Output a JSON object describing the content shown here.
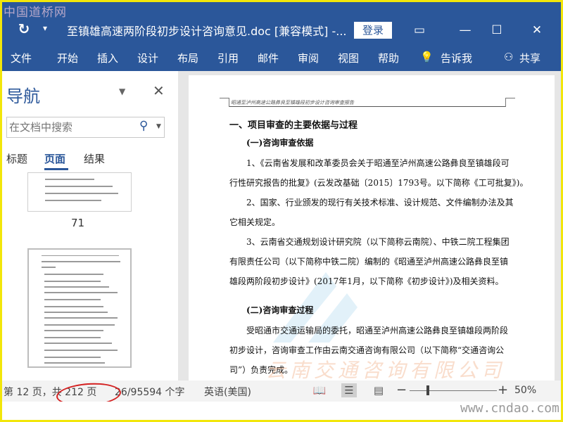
{
  "watermark_top": "中国道桥网",
  "watermark_bottom": "www.cndao.com",
  "watermark_page": "云南交通咨询有限公司",
  "titlebar": {
    "doc_title": "至镇雄高速两阶段初步设计咨询意见.doc [兼容模式]  -...",
    "login_label": "登录",
    "ribbon_display_icon": "ribbon-display-icon",
    "minimize_icon": "minimize-icon",
    "restore_icon": "restore-icon",
    "close_icon": "close-icon"
  },
  "menu": {
    "items": [
      "文件",
      "开始",
      "插入",
      "设计",
      "布局",
      "引用",
      "邮件",
      "审阅",
      "视图",
      "帮助"
    ],
    "tell_me": "告诉我",
    "share": "共享"
  },
  "nav": {
    "title": "导航",
    "search_placeholder": "在文档中搜索",
    "tabs": [
      "标题",
      "页面",
      "结果"
    ],
    "active_tab": "页面",
    "thumb_page_label": "71"
  },
  "document": {
    "header_text": "昭通至泸州高速公路彝良至镇雄段初步设计咨询审查报告",
    "heading1": "一、项目审查的主要依据与过程",
    "heading_a": "(一)咨询审查依据",
    "lines": [
      "1、《云南省发展和改革委员会关于昭通至泸州高速公路彝良至镇雄段可",
      "行性研究报告的批复》(云发改基础〔2015〕1793号。以下简称《工可批复》)。",
      "2、国家、行业颁发的现行有关技术标准、设计规范、文件编制办法及其",
      "它相关规定。",
      "3、云南省交通规划设计研究院（以下简称云南院）、中铁二院工程集团",
      "有限责任公司（以下简称中铁二院）编制的《昭通至泸州高速公路彝良至镇",
      "雄段两阶段初步设计》(2017年1月，以下简称《初步设计》)及相关资料。"
    ],
    "heading_b": "(二)咨询审查过程",
    "lines2": [
      "受昭通市交通运输局的委托，昭通至泸州高速公路彝良至镇雄段两阶段",
      "初步设计，咨询审查工作由云南交通咨询有限公司（以下简称“交通咨询公",
      "司”）负责完成。"
    ]
  },
  "status": {
    "page_info": "第 12 页，共 212 页",
    "word_count": "26/95594 个字",
    "language": "英语(美国)",
    "zoom": "50%",
    "zoom_level_percent": 50
  },
  "colors": {
    "accent": "#2b579a",
    "frame": "#f2e60a",
    "highlight_ellipse": "#d42020"
  }
}
